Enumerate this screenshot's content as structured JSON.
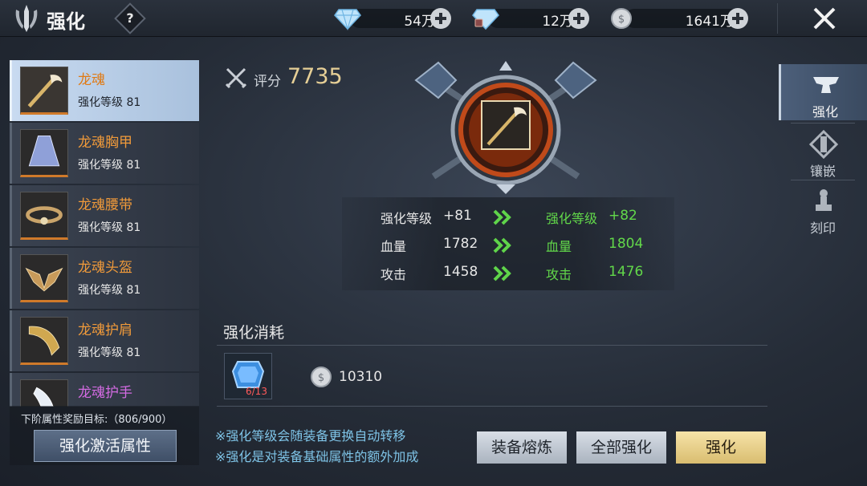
{
  "header": {
    "title": "强化",
    "help_label": "?",
    "currencies": [
      {
        "icon": "diamond-icon",
        "value": "54万"
      },
      {
        "icon": "bound-diamond-icon",
        "value": "12万"
      },
      {
        "icon": "silver-coin-icon",
        "value": "1641万"
      }
    ]
  },
  "equipment_list": [
    {
      "name": "龙魂",
      "level": "强化等级 81",
      "selected": true
    },
    {
      "name": "龙魂胸甲",
      "level": "强化等级 81"
    },
    {
      "name": "龙魂腰带",
      "level": "强化等级 81"
    },
    {
      "name": "龙魂头盔",
      "level": "强化等级 81"
    },
    {
      "name": "龙魂护肩",
      "level": "强化等级 81"
    },
    {
      "name": "龙魂护手",
      "level": ""
    }
  ],
  "reward": {
    "text": "下阶属性奖励目标:（806/900）"
  },
  "activate_button": "强化激活属性",
  "score": {
    "label": "评分",
    "value": "7735"
  },
  "stats": [
    {
      "name": "强化等级",
      "current": "+81",
      "next_name": "强化等级",
      "next": "+82"
    },
    {
      "name": "血量",
      "current": "1782",
      "next_name": "血量",
      "next": "1804"
    },
    {
      "name": "攻击",
      "current": "1458",
      "next_name": "攻击",
      "next": "1476"
    }
  ],
  "cost": {
    "title": "强化消耗",
    "item_count": "6/13",
    "coin_value": "10310"
  },
  "notes": [
    "※强化等级会随装备更换自动转移",
    "※强化是对装备基础属性的额外加成"
  ],
  "buttons": {
    "refine": "装备熔炼",
    "enhance_all": "全部强化",
    "enhance": "强化"
  },
  "right_tabs": [
    {
      "label": "强化",
      "active": true
    },
    {
      "label": "镶嵌"
    },
    {
      "label": "刻印"
    }
  ]
}
